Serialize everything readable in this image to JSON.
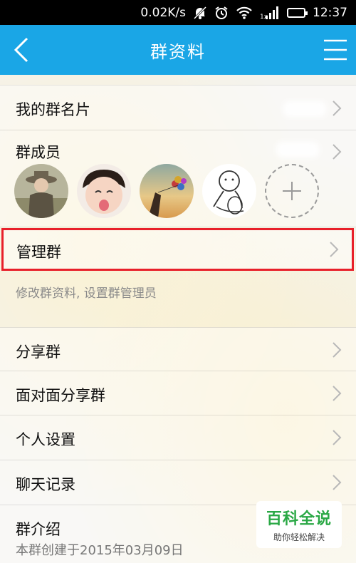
{
  "status_bar": {
    "speed": "0.02K/s",
    "signal_sub": "1x",
    "time": "12:37",
    "icons": [
      "mute-icon",
      "alarm-icon",
      "wifi-icon",
      "signal-icon",
      "battery-icon"
    ]
  },
  "header": {
    "title": "群资料",
    "back_icon": "back-chevron-icon",
    "menu_icon": "hamburger-menu-icon",
    "bg_color": "#1aa6e6"
  },
  "rows": {
    "my_card": {
      "label": "我的群名片"
    },
    "members": {
      "label": "群成员",
      "add_icon": "plus-icon"
    },
    "manage": {
      "label": "管理群",
      "hint": "修改群资料, 设置群管理员",
      "highlight_color": "#e8202a"
    },
    "share": {
      "label": "分享群"
    },
    "face_share": {
      "label": "面对面分享群"
    },
    "personal": {
      "label": "个人设置"
    },
    "chat_log": {
      "label": "聊天记录"
    },
    "intro": {
      "label": "群介绍",
      "value": "本群创建于2015年03月09日"
    }
  },
  "watermark": {
    "title": "百科全说",
    "subtitle": "助你轻松解决",
    "color": "#2aa845"
  }
}
